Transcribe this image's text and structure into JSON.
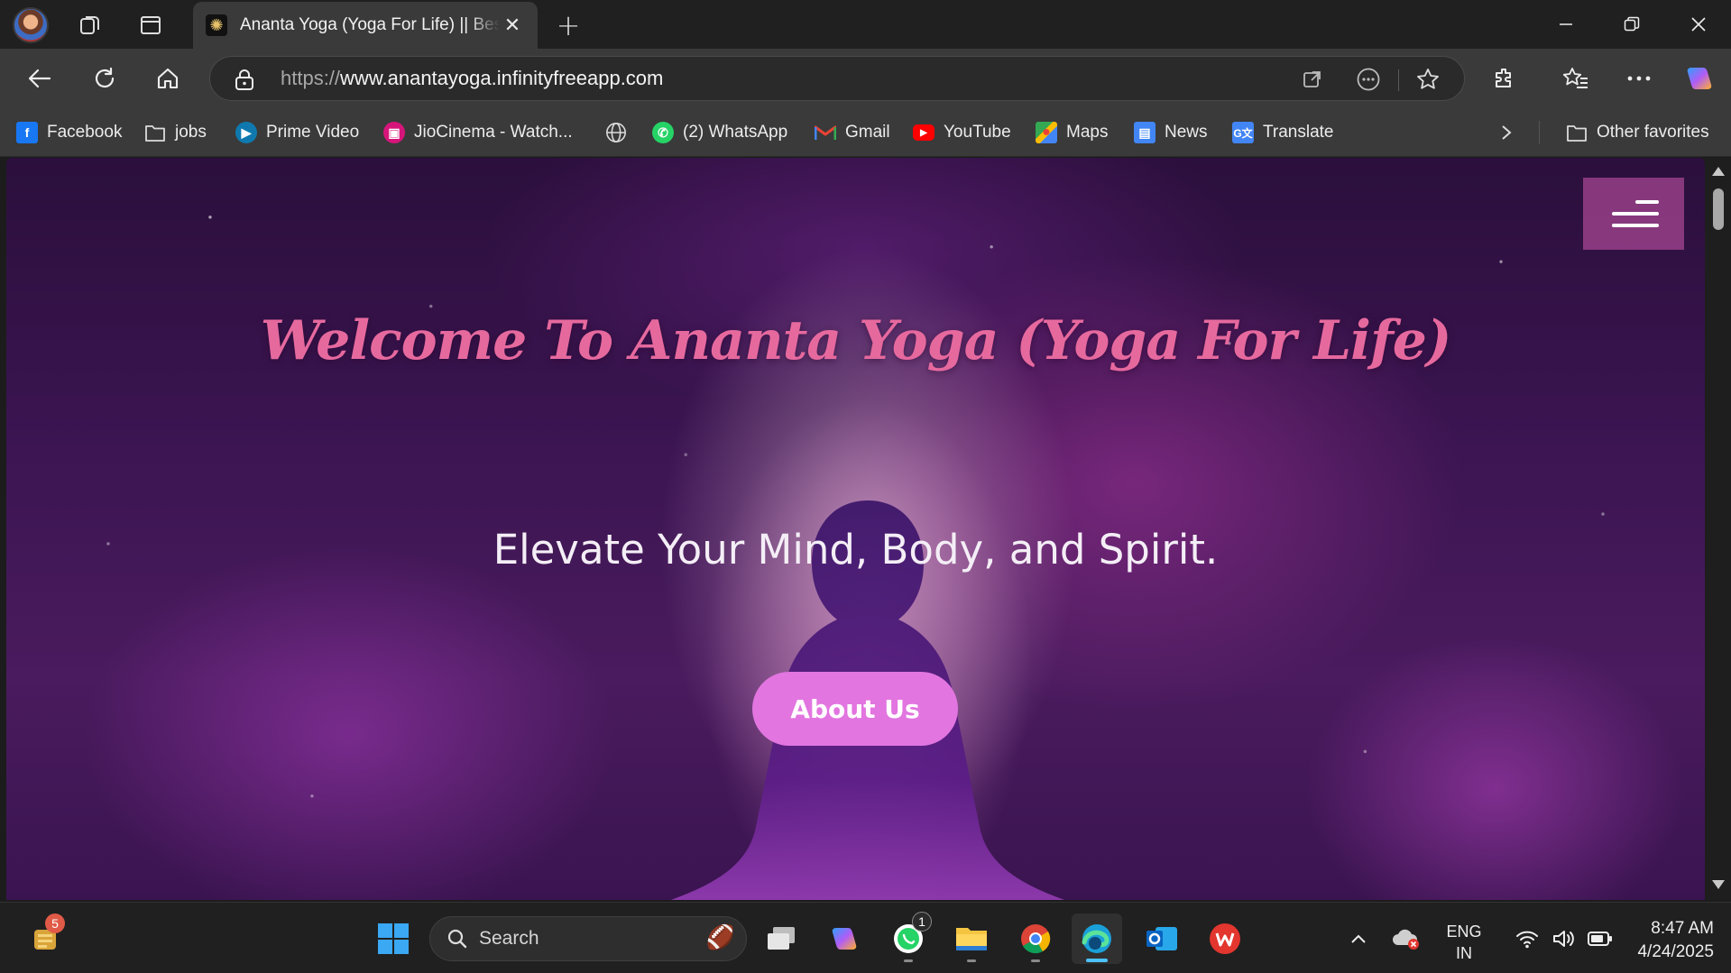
{
  "browser": {
    "tab": {
      "title": "Ananta Yoga (Yoga For Life) || Best Yoga Classes"
    },
    "address": {
      "scheme": "https://",
      "host": "www.anantayoga.infinityfreeapp.com"
    },
    "bookmarks": [
      {
        "label": "Facebook",
        "icon": "facebook-icon",
        "color": "#1877f2"
      },
      {
        "label": "jobs",
        "icon": "folder-icon",
        "color": ""
      },
      {
        "label": "Prime Video",
        "icon": "prime-video-icon",
        "color": "#1a98ff"
      },
      {
        "label": "JioCinema - Watch...",
        "icon": "jiocinema-icon",
        "color": "#d6157a"
      },
      {
        "label": "",
        "icon": "globe-icon",
        "color": ""
      },
      {
        "label": "(2) WhatsApp",
        "icon": "whatsapp-icon",
        "color": "#25d366"
      },
      {
        "label": "Gmail",
        "icon": "gmail-icon",
        "color": "#ea4335"
      },
      {
        "label": "YouTube",
        "icon": "youtube-icon",
        "color": "#ff0000"
      },
      {
        "label": "Maps",
        "icon": "maps-icon",
        "color": "#34a853"
      },
      {
        "label": "News",
        "icon": "news-icon",
        "color": "#4285f4"
      },
      {
        "label": "Translate",
        "icon": "translate-icon",
        "color": "#4285f4"
      }
    ],
    "other_favorites": "Other favorites"
  },
  "page": {
    "title": "Welcome To Ananta Yoga (Yoga For Life)",
    "subtitle": "Elevate Your Mind, Body, and Spirit.",
    "cta": "About Us",
    "colors": {
      "title": "#e6699e",
      "cta": "#e275e0",
      "menu": "#d25aaf"
    }
  },
  "taskbar": {
    "widgets_badge": "5",
    "search_label": "Search",
    "whatsapp_badge": "1",
    "language": "ENG",
    "region": "IN",
    "time": "8:47 AM",
    "date": "4/24/2025"
  }
}
